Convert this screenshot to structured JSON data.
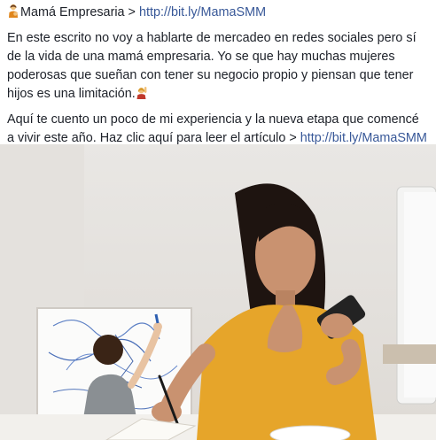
{
  "post": {
    "line1_label": "Mamá Empresaria > ",
    "line1_link": "http://bit.ly/MamaSMM",
    "para1": "En este escrito no voy a hablarte de mercadeo en redes sociales pero sí de la vida de una mamá empresaria. Yo se que hay muchas mujeres poderosas que sueñan con tener su negocio propio y piensan que tener hijos es una limitación.",
    "para2_text": "Aquí te cuento un poco de mi experiencia y la nueva etapa que comencé a vivir este año. Haz clic aquí para leer el artículo > ",
    "para2_link": "http://bit.ly/MamaSMM",
    "emoji_1": "woman-with-baby-emoji",
    "emoji_2": "woman-raising-hand-emoji"
  },
  "photo": {
    "subject": "woman working at desk with phone while child draws on whiteboard"
  },
  "colors": {
    "link": "#385898",
    "text": "#1d2129",
    "shirt": "#e6a52a"
  }
}
